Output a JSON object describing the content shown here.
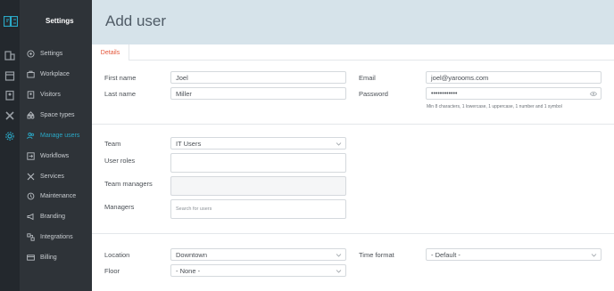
{
  "app": {
    "section_title": "Settings",
    "logo_icon": "yarooms-logo-icon",
    "accent_color": "#2aa8c6"
  },
  "rail": {
    "icons": [
      "building-icon",
      "calendar-icon",
      "badge-icon",
      "tools-icon",
      "gear-icon"
    ]
  },
  "sidebar": {
    "items": [
      {
        "label": "Settings",
        "icon": "gear-circle-icon"
      },
      {
        "label": "Workplace",
        "icon": "briefcase-icon"
      },
      {
        "label": "Visitors",
        "icon": "id-badge-icon"
      },
      {
        "label": "Space types",
        "icon": "shapes-icon"
      },
      {
        "label": "Manage users",
        "icon": "users-icon",
        "active": true
      },
      {
        "label": "Workflows",
        "icon": "workflow-icon"
      },
      {
        "label": "Services",
        "icon": "services-icon"
      },
      {
        "label": "Maintenance",
        "icon": "maintenance-icon"
      },
      {
        "label": "Branding",
        "icon": "megaphone-icon"
      },
      {
        "label": "Integrations",
        "icon": "integrations-icon"
      },
      {
        "label": "Billing",
        "icon": "credit-card-icon"
      }
    ]
  },
  "header": {
    "title": "Add user"
  },
  "tabs": [
    {
      "label": "Details",
      "active": true
    }
  ],
  "form": {
    "first_name": {
      "label": "First name",
      "value": "Joel"
    },
    "last_name": {
      "label": "Last name",
      "value": "Miller"
    },
    "email": {
      "label": "Email",
      "value": "joel@yarooms.com"
    },
    "password": {
      "label": "Password",
      "value": "••••••••••••",
      "hint": "Min 8 characters, 1 lowercase, 1 uppercase, 1 number and 1 symbol"
    },
    "team": {
      "label": "Team",
      "value": "IT Users"
    },
    "user_roles": {
      "label": "User roles",
      "value": ""
    },
    "team_managers": {
      "label": "Team managers",
      "value": ""
    },
    "managers": {
      "label": "Managers",
      "placeholder": "Search for users"
    },
    "location": {
      "label": "Location",
      "value": "Downtown"
    },
    "time_format": {
      "label": "Time format",
      "value": "- Default -"
    },
    "floor": {
      "label": "Floor",
      "value": "- None -"
    }
  }
}
